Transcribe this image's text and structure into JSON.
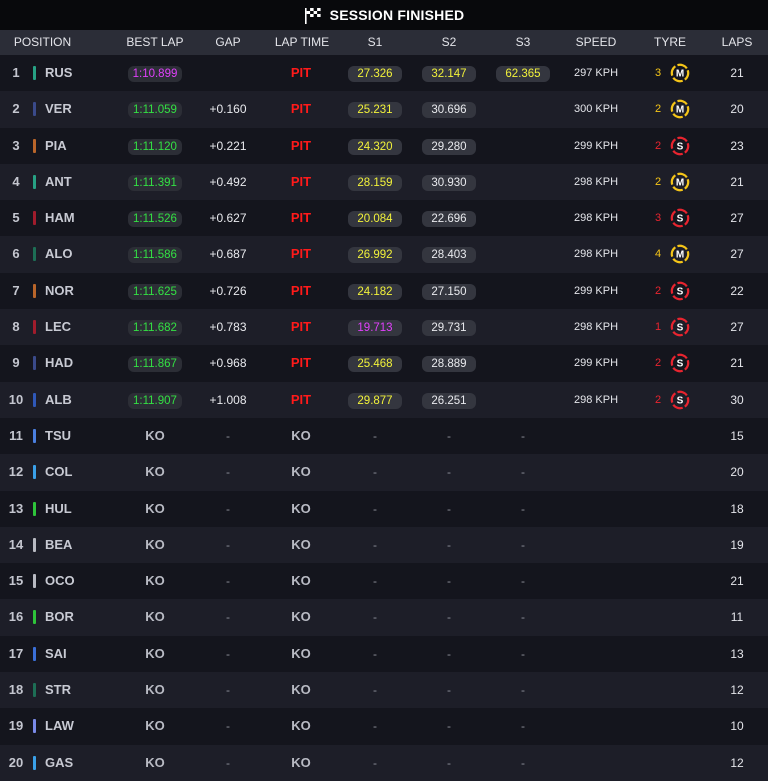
{
  "header": {
    "title": "SESSION FINISHED",
    "flag_icon": "checkered-flag-icon"
  },
  "columns": [
    "POSITION",
    "BEST LAP",
    "GAP",
    "LAP TIME",
    "S1",
    "S2",
    "S3",
    "SPEED",
    "TYRE",
    "LAPS"
  ],
  "colors": {
    "purple": "#e040fb",
    "green": "#33e043",
    "yellow": "#f2f23a",
    "white": "#e9eaee",
    "pit_red": "#ff1a1a",
    "tyre_medium": "#f5c518",
    "tyre_soft": "#e8242f"
  },
  "rows": [
    {
      "pos": "1",
      "driver": "RUS",
      "team_color": "#27a184",
      "best_lap": "1:10.899",
      "best_color": "purple",
      "gap": "",
      "lap_time": "PIT",
      "s1": "27.326",
      "s1_color": "yellow",
      "s2": "32.147",
      "s2_color": "yellow",
      "s3": "62.365",
      "s3_color": "yellow",
      "speed": "297 KPH",
      "tyre_laps": "3",
      "tyre": "M",
      "tyre_icon": "medium-tyre-icon",
      "laps": "21"
    },
    {
      "pos": "2",
      "driver": "VER",
      "team_color": "#3a4a8a",
      "best_lap": "1:11.059",
      "best_color": "green",
      "gap": "+0.160",
      "lap_time": "PIT",
      "s1": "25.231",
      "s1_color": "yellow",
      "s2": "30.696",
      "s2_color": "white",
      "s3": "",
      "s3_color": "white",
      "speed": "300 KPH",
      "tyre_laps": "2",
      "tyre": "M",
      "tyre_icon": "medium-tyre-icon",
      "laps": "20"
    },
    {
      "pos": "3",
      "driver": "PIA",
      "team_color": "#b9652a",
      "best_lap": "1:11.120",
      "best_color": "green",
      "gap": "+0.221",
      "lap_time": "PIT",
      "s1": "24.320",
      "s1_color": "yellow",
      "s2": "29.280",
      "s2_color": "white",
      "s3": "",
      "s3_color": "white",
      "speed": "299 KPH",
      "tyre_laps": "2",
      "tyre": "S",
      "tyre_icon": "soft-tyre-icon",
      "laps": "23"
    },
    {
      "pos": "4",
      "driver": "ANT",
      "team_color": "#27a184",
      "best_lap": "1:11.391",
      "best_color": "green",
      "gap": "+0.492",
      "lap_time": "PIT",
      "s1": "28.159",
      "s1_color": "yellow",
      "s2": "30.930",
      "s2_color": "white",
      "s3": "",
      "s3_color": "white",
      "speed": "298 KPH",
      "tyre_laps": "2",
      "tyre": "M",
      "tyre_icon": "medium-tyre-icon",
      "laps": "21"
    },
    {
      "pos": "5",
      "driver": "HAM",
      "team_color": "#a01c2c",
      "best_lap": "1:11.526",
      "best_color": "green",
      "gap": "+0.627",
      "lap_time": "PIT",
      "s1": "20.084",
      "s1_color": "yellow",
      "s2": "22.696",
      "s2_color": "white",
      "s3": "",
      "s3_color": "white",
      "speed": "298 KPH",
      "tyre_laps": "3",
      "tyre": "S",
      "tyre_icon": "soft-tyre-icon",
      "laps": "27"
    },
    {
      "pos": "6",
      "driver": "ALO",
      "team_color": "#1d6e55",
      "best_lap": "1:11.586",
      "best_color": "green",
      "gap": "+0.687",
      "lap_time": "PIT",
      "s1": "26.992",
      "s1_color": "yellow",
      "s2": "28.403",
      "s2_color": "white",
      "s3": "",
      "s3_color": "white",
      "speed": "298 KPH",
      "tyre_laps": "4",
      "tyre": "M",
      "tyre_icon": "medium-tyre-icon",
      "laps": "27"
    },
    {
      "pos": "7",
      "driver": "NOR",
      "team_color": "#b9652a",
      "best_lap": "1:11.625",
      "best_color": "green",
      "gap": "+0.726",
      "lap_time": "PIT",
      "s1": "24.182",
      "s1_color": "yellow",
      "s2": "27.150",
      "s2_color": "white",
      "s3": "",
      "s3_color": "white",
      "speed": "299 KPH",
      "tyre_laps": "2",
      "tyre": "S",
      "tyre_icon": "soft-tyre-icon",
      "laps": "22"
    },
    {
      "pos": "8",
      "driver": "LEC",
      "team_color": "#a01c2c",
      "best_lap": "1:11.682",
      "best_color": "green",
      "gap": "+0.783",
      "lap_time": "PIT",
      "s1": "19.713",
      "s1_color": "purple",
      "s2": "29.731",
      "s2_color": "white",
      "s3": "",
      "s3_color": "white",
      "speed": "298 KPH",
      "tyre_laps": "1",
      "tyre": "S",
      "tyre_icon": "soft-tyre-icon",
      "laps": "27"
    },
    {
      "pos": "9",
      "driver": "HAD",
      "team_color": "#3a4a8a",
      "best_lap": "1:11.867",
      "best_color": "green",
      "gap": "+0.968",
      "lap_time": "PIT",
      "s1": "25.468",
      "s1_color": "yellow",
      "s2": "28.889",
      "s2_color": "white",
      "s3": "",
      "s3_color": "white",
      "speed": "299 KPH",
      "tyre_laps": "2",
      "tyre": "S",
      "tyre_icon": "soft-tyre-icon",
      "laps": "21"
    },
    {
      "pos": "10",
      "driver": "ALB",
      "team_color": "#2f58b8",
      "best_lap": "1:11.907",
      "best_color": "green",
      "gap": "+1.008",
      "lap_time": "PIT",
      "s1": "29.877",
      "s1_color": "yellow",
      "s2": "26.251",
      "s2_color": "white",
      "s3": "",
      "s3_color": "white",
      "speed": "298 KPH",
      "tyre_laps": "2",
      "tyre": "S",
      "tyre_icon": "soft-tyre-icon",
      "laps": "30"
    },
    {
      "pos": "11",
      "driver": "TSU",
      "team_color": "#4a7fe0",
      "best_lap": "KO",
      "gap": "-",
      "lap_time": "KO",
      "s1": "-",
      "s2": "-",
      "s3": "-",
      "laps": "15"
    },
    {
      "pos": "12",
      "driver": "COL",
      "team_color": "#3aa0e8",
      "best_lap": "KO",
      "gap": "-",
      "lap_time": "KO",
      "s1": "-",
      "s2": "-",
      "s3": "-",
      "laps": "20"
    },
    {
      "pos": "13",
      "driver": "HUL",
      "team_color": "#2ec43a",
      "best_lap": "KO",
      "gap": "-",
      "lap_time": "KO",
      "s1": "-",
      "s2": "-",
      "s3": "-",
      "laps": "18"
    },
    {
      "pos": "14",
      "driver": "BEA",
      "team_color": "#b8bac2",
      "best_lap": "KO",
      "gap": "-",
      "lap_time": "KO",
      "s1": "-",
      "s2": "-",
      "s3": "-",
      "laps": "19"
    },
    {
      "pos": "15",
      "driver": "OCO",
      "team_color": "#b8bac2",
      "best_lap": "KO",
      "gap": "-",
      "lap_time": "KO",
      "s1": "-",
      "s2": "-",
      "s3": "-",
      "laps": "21"
    },
    {
      "pos": "16",
      "driver": "BOR",
      "team_color": "#2ec43a",
      "best_lap": "KO",
      "gap": "-",
      "lap_time": "KO",
      "s1": "-",
      "s2": "-",
      "s3": "-",
      "laps": "11"
    },
    {
      "pos": "17",
      "driver": "SAI",
      "team_color": "#3a6fd8",
      "best_lap": "KO",
      "gap": "-",
      "lap_time": "KO",
      "s1": "-",
      "s2": "-",
      "s3": "-",
      "laps": "13"
    },
    {
      "pos": "18",
      "driver": "STR",
      "team_color": "#1d6e55",
      "best_lap": "KO",
      "gap": "-",
      "lap_time": "KO",
      "s1": "-",
      "s2": "-",
      "s3": "-",
      "laps": "12"
    },
    {
      "pos": "19",
      "driver": "LAW",
      "team_color": "#7a8ae8",
      "best_lap": "KO",
      "gap": "-",
      "lap_time": "KO",
      "s1": "-",
      "s2": "-",
      "s3": "-",
      "laps": "10"
    },
    {
      "pos": "20",
      "driver": "GAS",
      "team_color": "#3aa0e8",
      "best_lap": "KO",
      "gap": "-",
      "lap_time": "KO",
      "s1": "-",
      "s2": "-",
      "s3": "-",
      "laps": "12"
    }
  ]
}
